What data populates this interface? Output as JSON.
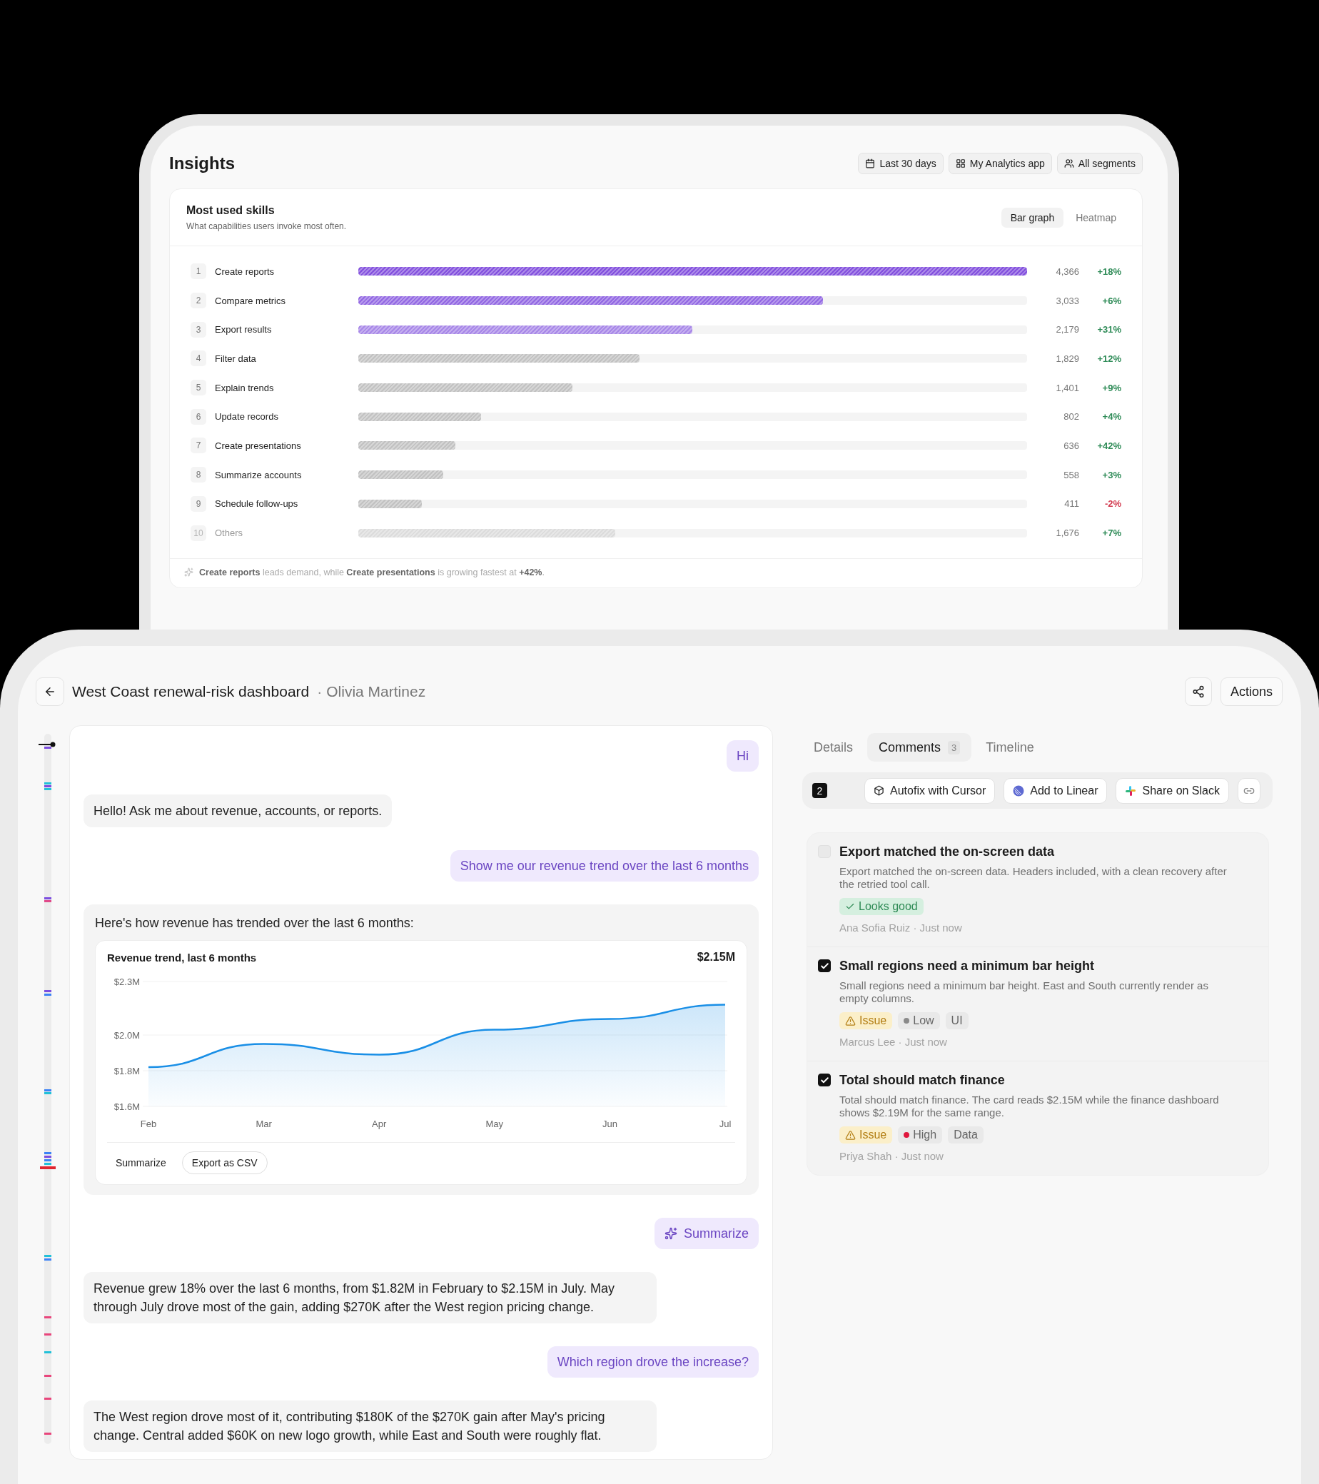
{
  "insights": {
    "title": "Insights",
    "filters": [
      {
        "label": "Last 30 days"
      },
      {
        "label": "My Analytics app"
      },
      {
        "label": "All segments"
      }
    ],
    "skills_card": {
      "title": "Most used skills",
      "subtitle": "What capabilities users invoke most often.",
      "views": [
        {
          "label": "Bar graph",
          "selected": true
        },
        {
          "label": "Heatmap",
          "selected": false
        }
      ],
      "rows": [
        {
          "rank": "1",
          "label": "Create reports",
          "kind": "skill",
          "level": 1,
          "color": "#8452de",
          "count": "4,366",
          "change": {
            "text": "+18%",
            "color": "#2e8b57"
          }
        },
        {
          "rank": "2",
          "label": "Compare metrics",
          "kind": "skill",
          "level": 0.695,
          "color": "#9369e3",
          "count": "3,033",
          "change": {
            "text": "+6%",
            "color": "#2e8b57"
          }
        },
        {
          "rank": "3",
          "label": "Export results",
          "kind": "skill",
          "level": 0.499,
          "color": "#a888e8",
          "count": "2,179",
          "change": {
            "text": "+31%",
            "color": "#2e8b57"
          }
        },
        {
          "rank": "4",
          "label": "Filter data",
          "kind": "skill",
          "level": 0.42,
          "color": "#c2c2c2",
          "count": "1,829",
          "change": {
            "text": "+12%",
            "color": "#2e8b57"
          }
        },
        {
          "rank": "5",
          "label": "Explain trends",
          "kind": "skill",
          "level": 0.32,
          "color": "#c2c2c2",
          "count": "1,401",
          "change": {
            "text": "+9%",
            "color": "#2e8b57"
          }
        },
        {
          "rank": "6",
          "label": "Update records",
          "kind": "skill",
          "level": 0.184,
          "color": "#c2c2c2",
          "count": "802",
          "change": {
            "text": "+4%",
            "color": "#2e8b57"
          }
        },
        {
          "rank": "7",
          "label": "Create presentations",
          "kind": "skill",
          "level": 0.145,
          "color": "#c2c2c2",
          "count": "636",
          "change": {
            "text": "+42%",
            "color": "#2e8b57"
          }
        },
        {
          "rank": "8",
          "label": "Summarize accounts",
          "kind": "skill",
          "level": 0.127,
          "color": "#c2c2c2",
          "count": "558",
          "change": {
            "text": "+3%",
            "color": "#2e8b57"
          }
        },
        {
          "rank": "9",
          "label": "Schedule follow-ups",
          "kind": "skill",
          "level": 0.095,
          "color": "#c2c2c2",
          "count": "411",
          "change": {
            "text": "-2%",
            "color": "#d23a4f"
          }
        },
        {
          "rank": "10",
          "label": "Others",
          "kind": "other",
          "level": 0.384,
          "color": "#dcdcdc",
          "count": "1,676",
          "change": {
            "text": "+7%",
            "color": "#2e8b57"
          }
        }
      ],
      "footer": "**Create reports** leads demand, while **Create presentations** is growing fastest at **+42%**."
    }
  },
  "conversation": {
    "title": "West Coast renewal-risk dashboard",
    "separator": "·",
    "owner": "Olivia Martinez",
    "actions_label": "Actions",
    "messages": [
      {
        "kind": "user",
        "text": "Hi"
      },
      {
        "kind": "assistant",
        "text": "Hello! Ask me about revenue, accounts, or reports."
      },
      {
        "kind": "user",
        "text": "Show me our revenue trend over the last 6 months"
      },
      {
        "kind": "assistant_chart",
        "text": "Here's how revenue has trended over the last 6 months:",
        "chart": {
          "title": "Revenue trend, last 6 months",
          "total": "$2.15M",
          "chart_data": {
            "type": "area",
            "categories": [
              "Feb",
              "Mar",
              "Apr",
              "May",
              "Jun",
              "Jul"
            ],
            "series": [
              {
                "color": "#1a8fe6",
                "values": [
                  1.82,
                  1.95,
                  1.89,
                  2.03,
                  2.09,
                  2.17
                ]
              }
            ],
            "ylim": [
              1.6,
              2.3
            ],
            "yticks": [
              {
                "value": 2.3,
                "label": "$2.3M"
              },
              {
                "value": 2.0,
                "label": "$2.0M"
              },
              {
                "value": 1.8,
                "label": "$1.8M"
              },
              {
                "value": 1.6,
                "label": "$1.6M"
              }
            ]
          },
          "actions": [
            {
              "label": "Summarize",
              "kind": "plain"
            },
            {
              "label": "Export as CSV",
              "kind": "outline"
            }
          ]
        }
      },
      {
        "kind": "user_action",
        "text": "Summarize"
      },
      {
        "kind": "assistant",
        "text": "Revenue grew 18% over the last 6 months, from $1.82M in February to $2.15M in July. May through July drove most of the gain, adding $270K after the West region pricing change."
      },
      {
        "kind": "user",
        "text": "Which region drove the increase?"
      },
      {
        "kind": "assistant",
        "text": "The West region drove most of it, contributing $180K of the $270K gain after May's pricing change. Central added $60K on new logo growth, while East and South were roughly flat."
      }
    ]
  },
  "details": {
    "tabs": [
      {
        "label": "Details",
        "selected": false
      },
      {
        "label": "Comments",
        "count": "3",
        "selected": true
      },
      {
        "label": "Timeline",
        "selected": false
      }
    ],
    "toolbar": {
      "selected_count": "2",
      "actions": [
        {
          "label": "Autofix with Cursor"
        },
        {
          "label": "Add to Linear"
        },
        {
          "label": "Share on Slack"
        }
      ]
    },
    "comments": [
      {
        "checked": false,
        "title": "Export matched the on-screen data",
        "body": "Export matched the on-screen data. Headers included, with a clean recovery after the retried tool call.",
        "tags": [
          {
            "kind": "success",
            "label": "Looks good"
          }
        ],
        "meta": "Ana Sofia Ruiz · Just now"
      },
      {
        "checked": true,
        "title": "Small regions need a minimum bar height",
        "body": "Small regions need a minimum bar height. East and South currently render as empty columns.",
        "tags": [
          {
            "kind": "issue",
            "label": "Issue"
          },
          {
            "kind": "priority",
            "label": "Low",
            "color": "#8a8a8a"
          },
          {
            "kind": "label",
            "label": "UI"
          }
        ],
        "meta": "Marcus Lee · Just now"
      },
      {
        "checked": true,
        "title": "Total should match finance",
        "body": "Total should match finance. The card reads $2.15M while the finance dashboard shows $2.19M for the same range.",
        "tags": [
          {
            "kind": "issue",
            "label": "Issue"
          },
          {
            "kind": "priority",
            "label": "High",
            "color": "#e0173d"
          },
          {
            "kind": "label",
            "label": "Data"
          }
        ],
        "meta": "Priya Shah · Just now"
      }
    ]
  }
}
